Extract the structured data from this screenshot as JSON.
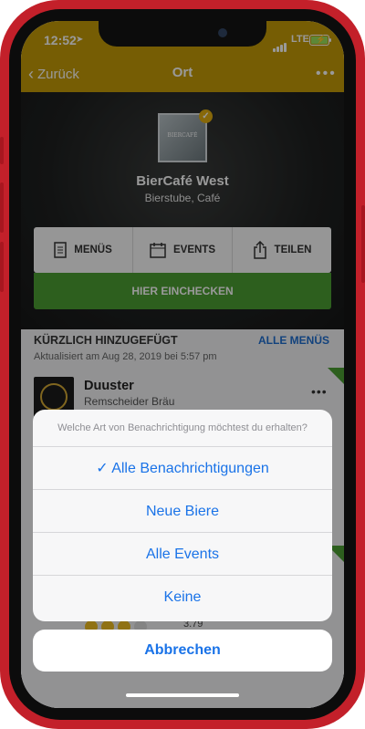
{
  "status_bar": {
    "time": "12:52",
    "network": "LTE",
    "battery_level": 1.0
  },
  "nav": {
    "back_label": "Zurück",
    "title": "Ort",
    "more_icon": "ellipsis-icon"
  },
  "venue": {
    "name": "BierCafé West",
    "type": "Bierstube, Café",
    "logo_text": "BIERCAFÉ"
  },
  "actions": {
    "menus_label": "MENÜS",
    "events_label": "EVENTS",
    "share_label": "TEILEN",
    "checkin_label": "HIER EINCHECKEN"
  },
  "recent": {
    "title": "KÜRZLICH HINZUGEFÜGT",
    "all_menus_label": "ALLE MENÜS",
    "updated": "Aktualisiert am Aug 28, 2019 bei 5:57 pm",
    "items": [
      {
        "name": "Duuster",
        "brewery": "Remscheider Bräu"
      }
    ],
    "partial_rating": "3.79"
  },
  "sheet": {
    "header": "Welche Art von Benachrichtigung möchtest du erhalten?",
    "options": [
      {
        "label": "Alle Benachrichtigungen",
        "selected": true
      },
      {
        "label": "Neue Biere",
        "selected": false
      },
      {
        "label": "Alle Events",
        "selected": false
      },
      {
        "label": "Keine",
        "selected": false
      }
    ],
    "cancel_label": "Abbrechen",
    "check_glyph": "✓"
  },
  "colors": {
    "header": "#c59c08",
    "accent_green": "#4c9e32",
    "link_blue": "#1a73e8",
    "frame_red": "#c3202a"
  }
}
